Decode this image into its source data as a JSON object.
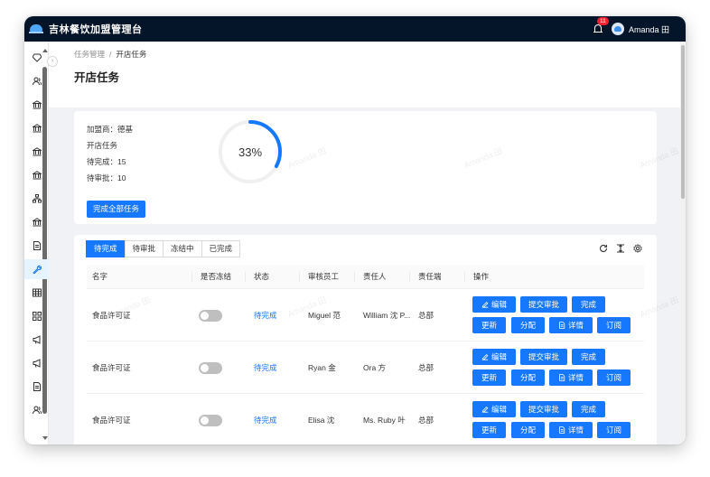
{
  "header": {
    "app_title": "吉林餐饮加盟管理台",
    "notification_count": "11",
    "username": "Amanda 田"
  },
  "breadcrumb": {
    "parent": "任务管理",
    "separator": "/",
    "current": "开店任务"
  },
  "page": {
    "title": "开店任务"
  },
  "info": {
    "franchisee": "加盟商：德基",
    "task_name": "开店任务",
    "pending_complete": "待完成：15",
    "pending_review": "待审批：10",
    "complete_all_label": "完成全部任务",
    "progress_text": "33%",
    "progress_value": 0.33
  },
  "tabs": [
    {
      "label": "待完成",
      "active": true
    },
    {
      "label": "待审批",
      "active": false
    },
    {
      "label": "冻结中",
      "active": false
    },
    {
      "label": "已完成",
      "active": false
    }
  ],
  "table": {
    "columns": [
      "名字",
      "是否冻结",
      "状态",
      "审核员工",
      "责任人",
      "责任端",
      "操作"
    ],
    "rows": [
      {
        "name": "食品许可证",
        "status": "待完成",
        "reviewer": "Miguel 范",
        "owner": "William 沈 P...",
        "side": "总部"
      },
      {
        "name": "食品许可证",
        "status": "待完成",
        "reviewer": "Ryan 金",
        "owner": "Ora 方",
        "side": "总部"
      },
      {
        "name": "食品许可证",
        "status": "待完成",
        "reviewer": "Elisa 沈",
        "owner": "Ms. Ruby 叶",
        "side": "总部"
      }
    ],
    "actions": {
      "edit": "编辑",
      "submit_review": "提交审批",
      "complete": "完成",
      "update": "更新",
      "assign": "分配",
      "detail": "详情",
      "subscribe": "订阅"
    }
  },
  "watermark_text": "Amanda 田",
  "colors": {
    "primary": "#1677ff",
    "header_bg": "#051529"
  },
  "icons": [
    "diamond-icon",
    "users-icon",
    "bank-icon",
    "file-icon",
    "wrench-icon",
    "table-icon",
    "grid-icon",
    "megaphone-icon",
    "reload-icon",
    "column-height-icon",
    "setting-icon",
    "edit-icon",
    "file-text-icon",
    "bell-icon"
  ]
}
